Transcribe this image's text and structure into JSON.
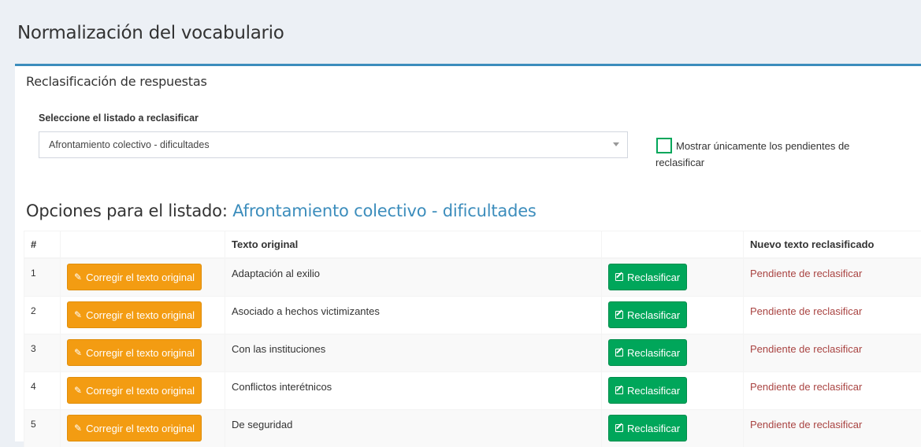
{
  "header": {
    "title": "Normalización del vocabulario"
  },
  "box": {
    "title": "Reclasificación de respuestas"
  },
  "form": {
    "select_label": "Seleccione el listado a reclasificar",
    "select_value": "Afrontamiento colectivo - dificultades",
    "checkbox_label": "Mostrar únicamente los pendientes de reclasificar",
    "checkbox_checked": false
  },
  "section": {
    "heading_prefix": "Opciones para el listado:",
    "heading_list": "Afrontamiento colectivo - dificultades"
  },
  "table": {
    "headers": {
      "num": "#",
      "action1": "",
      "original": "Texto original",
      "action2": "",
      "new_text": "Nuevo texto reclasificado"
    },
    "rows": [
      {
        "num": "1",
        "correct_label": "Corregir el texto original",
        "original": "Adaptación al exilio",
        "reclassify_label": "Reclasificar",
        "status": "Pendiente de reclasificar"
      },
      {
        "num": "2",
        "correct_label": "Corregir el texto original",
        "original": "Asociado a hechos victimizantes",
        "reclassify_label": "Reclasificar",
        "status": "Pendiente de reclasificar"
      },
      {
        "num": "3",
        "correct_label": "Corregir el texto original",
        "original": "Con las instituciones",
        "reclassify_label": "Reclasificar",
        "status": "Pendiente de reclasificar"
      },
      {
        "num": "4",
        "correct_label": "Corregir el texto original",
        "original": "Conflictos interétnicos",
        "reclassify_label": "Reclasificar",
        "status": "Pendiente de reclasificar"
      },
      {
        "num": "5",
        "correct_label": "Corregir el texto original",
        "original": "De seguridad",
        "reclassify_label": "Reclasificar",
        "status": "Pendiente de reclasificar"
      }
    ]
  },
  "colors": {
    "accent": "#3c8dbc",
    "warning": "#f39c12",
    "success": "#00a65a",
    "pending": "#a94442"
  },
  "icons": {
    "correct_button": "pencil-icon",
    "reclassify_button": "edit-icon",
    "select": "chevron-down-icon"
  }
}
